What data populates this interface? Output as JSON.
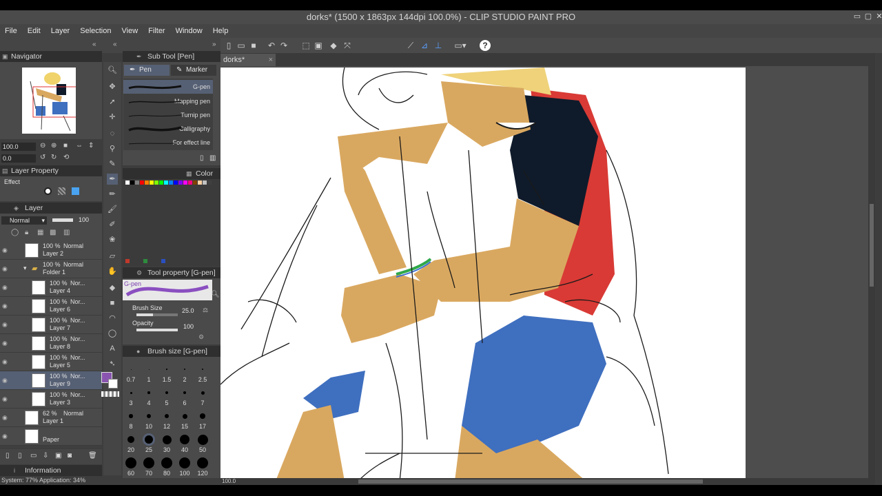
{
  "window": {
    "title": "dorks* (1500 x 1863px 144dpi 100.0%) - CLIP STUDIO PAINT PRO"
  },
  "menu": [
    "File",
    "Edit",
    "Layer",
    "Selection",
    "View",
    "Filter",
    "Window",
    "Help"
  ],
  "navigator": {
    "title": "Navigator",
    "zoom": "100.0",
    "rotation": "0.0"
  },
  "subtool": {
    "title": "Sub Tool [Pen]",
    "tabs": [
      "Pen",
      "Marker"
    ],
    "brushes": [
      "G-pen",
      "Mapping pen",
      "Turnip pen",
      "Calligraphy",
      "For effect line"
    ]
  },
  "color": {
    "title": "Color"
  },
  "layer_property": {
    "title": "Layer Property",
    "effect_label": "Effect"
  },
  "layer_panel": {
    "title": "Layer",
    "blend_mode": "Normal",
    "opacity": "100",
    "layers": [
      {
        "pct": "100 %",
        "mode": "Normal",
        "name": "Layer 2"
      },
      {
        "pct": "100 %",
        "mode": "Normal",
        "name": "Folder 1"
      },
      {
        "pct": "100 %",
        "mode": "Nor...",
        "name": "Layer 4"
      },
      {
        "pct": "100 %",
        "mode": "Nor...",
        "name": "Layer 6"
      },
      {
        "pct": "100 %",
        "mode": "Nor...",
        "name": "Layer 7"
      },
      {
        "pct": "100 %",
        "mode": "Nor...",
        "name": "Layer 8"
      },
      {
        "pct": "100 %",
        "mode": "Nor...",
        "name": "Layer 5"
      },
      {
        "pct": "100 %",
        "mode": "Nor...",
        "name": "Layer 9"
      },
      {
        "pct": "100 %",
        "mode": "Nor...",
        "name": "Layer 3"
      },
      {
        "pct": "62 %",
        "mode": "Normal",
        "name": "Layer 1"
      },
      {
        "pct": "",
        "mode": "",
        "name": "Paper"
      }
    ]
  },
  "tool_property": {
    "title": "Tool property [G-pen]",
    "brush_name": "G-pen",
    "brush_size_label": "Brush Size",
    "brush_size": "25.0",
    "opacity_label": "Opacity",
    "opacity": "100"
  },
  "brush_size_panel": {
    "title": "Brush size [G-pen]",
    "sizes": [
      "0.7",
      "1",
      "1.5",
      "2",
      "2.5",
      "3",
      "4",
      "5",
      "6",
      "7",
      "8",
      "10",
      "12",
      "15",
      "17",
      "20",
      "25",
      "30",
      "40",
      "50",
      "60",
      "70",
      "80",
      "100",
      "120"
    ]
  },
  "canvas": {
    "tab": "dorks*",
    "zoom": "100.0"
  },
  "information": {
    "title": "Information",
    "status": "System: 77%  Application: 34%"
  },
  "colors": {
    "accent": "#566074",
    "panel": "#4a4a4a",
    "skin": "#d9a860",
    "shirt_navy": "#0f1b2b",
    "shirt_red": "#d93a35",
    "shorts": "#3f6fbf"
  }
}
